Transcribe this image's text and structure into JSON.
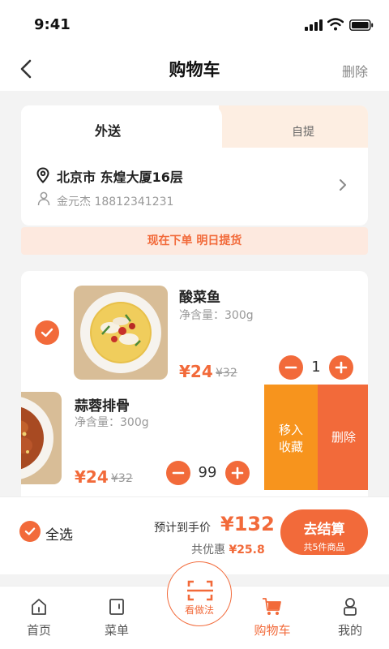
{
  "status_bar": {
    "time": "9:41"
  },
  "nav": {
    "title": "购物车",
    "delete_label": "删除"
  },
  "delivery": {
    "tabs": [
      {
        "label": "外送",
        "active": true
      },
      {
        "label": "自提",
        "active": false
      }
    ],
    "address": "北京市 东煌大厦16层",
    "contact": "金元杰 18812341231"
  },
  "notice": "现在下单 明日提货",
  "cart": {
    "items": [
      {
        "name": "酸菜鱼",
        "weight": "净含量：300g",
        "price": "¥24",
        "old_price": "¥32",
        "qty": "1",
        "checked": true
      },
      {
        "name": "蒜蓉排骨",
        "weight": "净含量：300g",
        "price": "¥24",
        "old_price": "¥32",
        "qty": "99",
        "checked": true
      }
    ],
    "swipe_actions": {
      "favorite": "移入\n收藏",
      "favorite_l1": "移入",
      "favorite_l2": "收藏",
      "delete": "删除"
    }
  },
  "checkout": {
    "select_all": "全选",
    "estimate_label": "预计到手价",
    "estimate_price": "¥132",
    "discount_label": "共优惠",
    "discount_value": "¥25.8",
    "button_label": "去结算",
    "button_sub": "共5件商品"
  },
  "tabbar": {
    "items": [
      {
        "label": "首页",
        "icon": "home-icon"
      },
      {
        "label": "菜单",
        "icon": "menu-icon"
      },
      {
        "label": "看做法",
        "icon": "scan-icon"
      },
      {
        "label": "购物车",
        "icon": "cart-icon",
        "active": true
      },
      {
        "label": "我的",
        "icon": "user-icon"
      }
    ]
  },
  "colors": {
    "accent": "#f26a3a",
    "orange": "#f7941d",
    "tab_tint": "#fdeee2"
  }
}
